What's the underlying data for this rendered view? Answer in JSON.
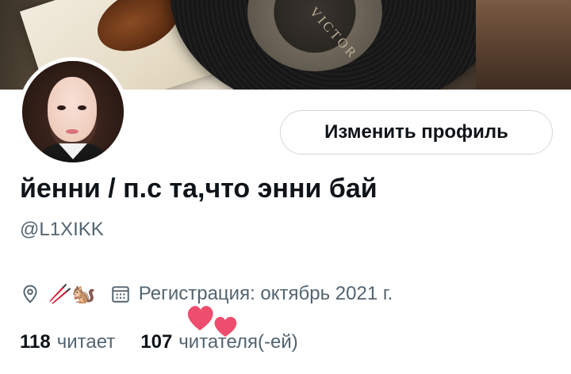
{
  "banner": {
    "record_label_text": "VICTOR"
  },
  "profile": {
    "display_name": "йенни / п.с та,что энни бай",
    "handle": "@L1XIKK",
    "edit_button_label": "Изменить профиль",
    "location_value": "🥢🐿️",
    "join_date_text": "Регистрация: октябрь 2021 г."
  },
  "stats": {
    "following_count": "118",
    "following_label": "читает",
    "followers_count": "107",
    "followers_label": "читателя(-ей)"
  },
  "icons": {
    "location": "location-pin-icon",
    "calendar": "calendar-icon",
    "sticker": "hearts-sticker-icon"
  },
  "colors": {
    "text_primary": "#0f1419",
    "text_secondary": "#536471",
    "button_border": "#cfd9de",
    "heart": "#ee4d6d"
  }
}
